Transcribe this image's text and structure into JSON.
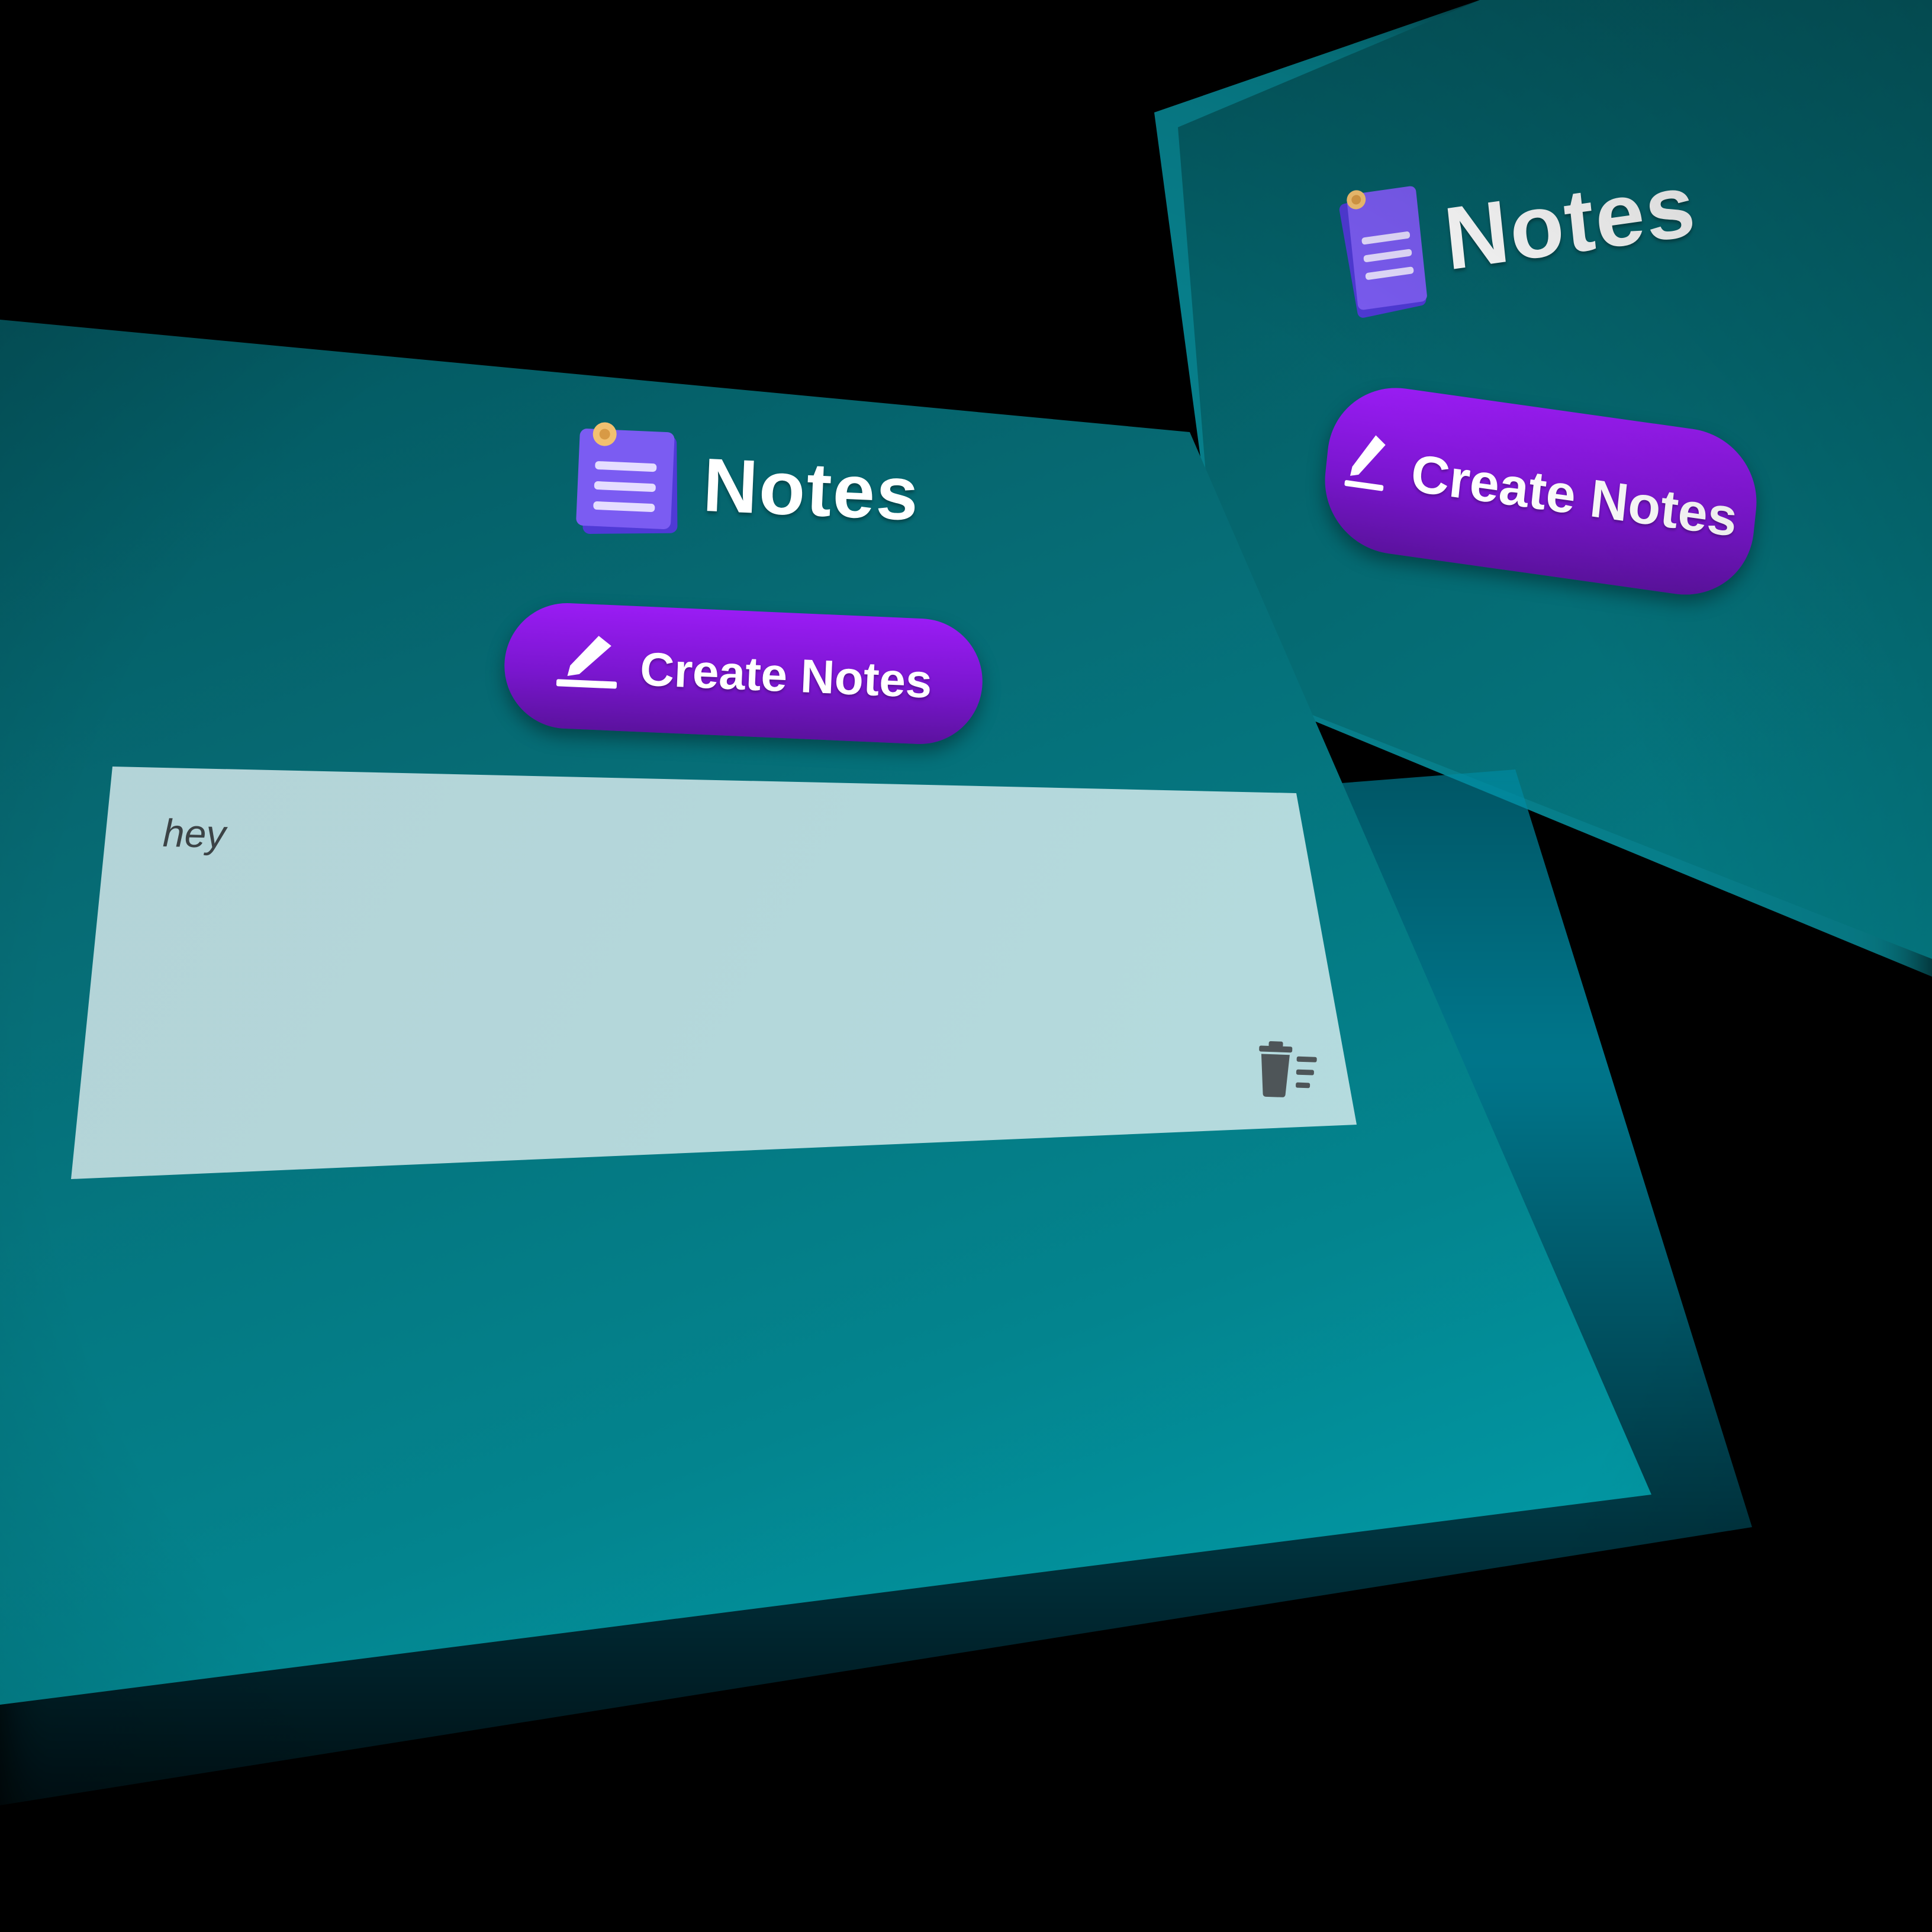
{
  "app": {
    "title": "Notes",
    "logo_icon": "notes-icon"
  },
  "toolbar": {
    "create_label": "Create Notes",
    "create_icon": "pencil-icon"
  },
  "notes": [
    {
      "text": "hey",
      "delete_icon": "trash-icon"
    }
  ],
  "colors": {
    "background_start": "#024a52",
    "background_end": "#00b0bf",
    "button_top": "#9a1cf4",
    "button_bottom": "#5b129e",
    "note_card": "#b4dadd",
    "title": "#ffffff"
  }
}
